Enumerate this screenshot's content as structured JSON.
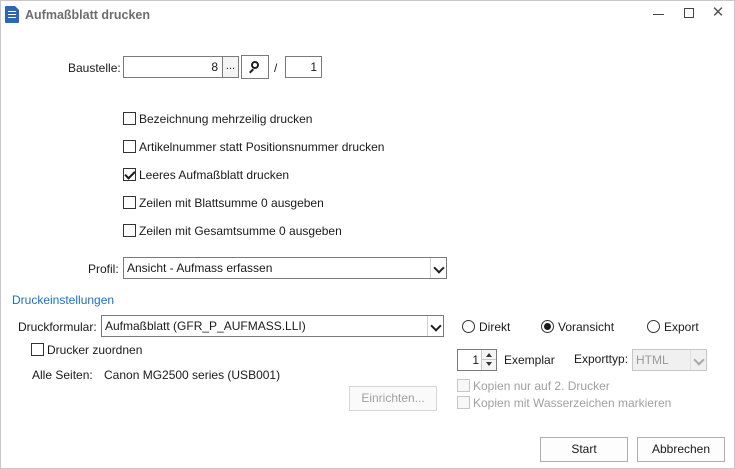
{
  "window": {
    "title": "Aufmaßblatt drucken"
  },
  "baustelle": {
    "label": "Baustelle:",
    "value": "8",
    "browse_label": "...",
    "separator": "/",
    "sub_value": "1"
  },
  "options": [
    {
      "label": "Bezeichnung mehrzeilig drucken",
      "checked": false
    },
    {
      "label": "Artikelnummer statt Positionsnummer drucken",
      "checked": false
    },
    {
      "label": "Leeres Aufmaßblatt drucken",
      "checked": true
    },
    {
      "label": "Zeilen mit Blattsumme 0 ausgeben",
      "checked": false
    },
    {
      "label": "Zeilen mit Gesamtsumme 0 ausgeben",
      "checked": false
    }
  ],
  "profil": {
    "label": "Profil:",
    "value": "Ansicht - Aufmass erfassen"
  },
  "druckeinstellungen": {
    "title": "Druckeinstellungen",
    "formular_label": "Druckformular:",
    "formular_value": "Aufmaßblatt (GFR_P_AUFMASS.LLI)",
    "drucker_zuordnen_label": "Drucker zuordnen",
    "drucker_zuordnen_checked": false,
    "alle_seiten_label": "Alle Seiten:",
    "alle_seiten_value": "Canon MG2500 series (USB001)",
    "einrichten_label": "Einrichten...",
    "output_modes": [
      {
        "label": "Direkt",
        "selected": false
      },
      {
        "label": "Voransicht",
        "selected": true
      },
      {
        "label": "Export",
        "selected": false
      }
    ],
    "exemplar_value": "1",
    "exemplar_label": "Exemplar",
    "exporttyp_label": "Exporttyp:",
    "exporttyp_value": "HTML",
    "kopien_2_drucker_label": "Kopien nur auf 2. Drucker",
    "kopien_wasserzeichen_label": "Kopien mit Wasserzeichen markieren"
  },
  "footer": {
    "start_label": "Start",
    "cancel_label": "Abbrechen"
  },
  "icons": {
    "app": "document-print-icon",
    "search": "search-icon",
    "minimize": "minimize-icon",
    "maximize": "maximize-icon",
    "close": "close-icon"
  },
  "colors": {
    "section_title": "#1f6fbf",
    "app_icon": "#2b67b4"
  }
}
